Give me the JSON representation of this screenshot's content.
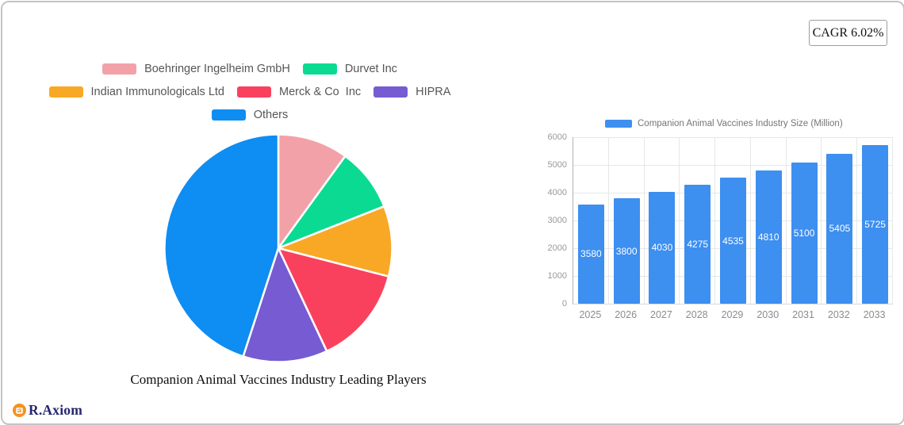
{
  "cagr_badge": {
    "label": "CAGR 6.02%"
  },
  "brand": {
    "text": "R.Axiom",
    "icon": "growth-chart-icon",
    "icon_color": "#f59120"
  },
  "chart_data": [
    {
      "type": "pie",
      "title": "Companion Animal Vaccines Industry Leading Players",
      "legend_position": "top",
      "start_angle": "12-oclock-clockwise",
      "slices": [
        {
          "label": "Boehringer Ingelheim GmbH",
          "value_pct": 10,
          "color": "#f3a1a8",
          "legend_row": 0
        },
        {
          "label": "Durvet Inc",
          "value_pct": 9,
          "color": "#0bdb92",
          "legend_row": 0
        },
        {
          "label": "Indian Immunologicals Ltd",
          "value_pct": 10,
          "color": "#f9a825",
          "legend_row": 1
        },
        {
          "label": "Merck & Co  Inc",
          "value_pct": 14,
          "color": "#f9415e",
          "legend_row": 1
        },
        {
          "label": "HIPRA",
          "value_pct": 12,
          "color": "#765bd2",
          "legend_row": 1
        },
        {
          "label": "Others",
          "value_pct": 45,
          "color": "#0e8df2",
          "legend_row": 2
        }
      ]
    },
    {
      "type": "bar",
      "series_label": "Companion Animal Vaccines Industry Size (Million)",
      "legend_position": "top",
      "bar_color": "#3d8ff0",
      "value_label_color": "#ffffff",
      "categories": [
        "2025",
        "2026",
        "2027",
        "2028",
        "2029",
        "2030",
        "2031",
        "2032",
        "2033"
      ],
      "values": [
        3580,
        3800,
        4030,
        4275,
        4535,
        4810,
        5100,
        5405,
        5725
      ],
      "xlabel": "",
      "ylabel": "",
      "ylim": [
        0,
        6000
      ],
      "y_ticks": [
        0,
        1000,
        2000,
        3000,
        4000,
        5000,
        6000
      ],
      "grid": true
    }
  ]
}
